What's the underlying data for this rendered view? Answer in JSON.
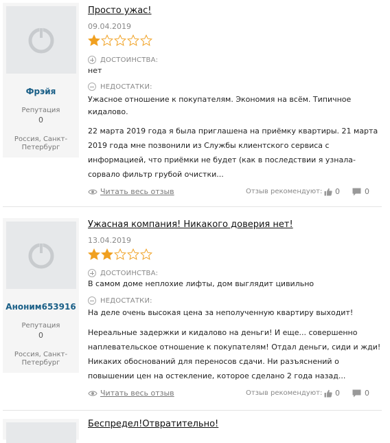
{
  "reviews": [
    {
      "user": {
        "name": "Фрэйя",
        "rep_label": "Репутация",
        "rep_value": "0",
        "location": "Россия, Санкт-Петербург"
      },
      "title": "Просто ужас!",
      "date": "09.04.2019",
      "rating": 1,
      "pros_label": "ДОСТОИНСТВА:",
      "pros": "нет",
      "cons_label": "НЕДОСТАТКИ:",
      "cons": "Ужасное отношение к покупателям. Экономия на всём. Типичное кидалово.",
      "body": "22 марта 2019 года я была приглашена на приёмку квартиры. 21 марта 2019 года мне позвонили из Службы клиентского сервиса с информацией, что приёмки не будет (как в последствии я узнала-сорвало фильтр грубой очистки...",
      "read_more": "Читать весь отзыв",
      "recommend_label": "Отзыв рекомендуют:",
      "likes": "0",
      "comments": "0"
    },
    {
      "user": {
        "name": "Аноним653916",
        "rep_label": "Репутация",
        "rep_value": "0",
        "location": "Россия, Санкт-Петербург"
      },
      "title": "Ужасная компания! Никакого доверия нет!",
      "date": "13.04.2019",
      "rating": 2,
      "pros_label": "ДОСТОИНСТВА:",
      "pros": "В самом доме неплохие лифты, дом выглядит цивильно",
      "cons_label": "НЕДОСТАТКИ:",
      "cons": "На деле очень высокая цена за неполученную квартиру выходит!",
      "body": "Нереальные задержки и кидалово на деньги! И еще... совершенно наплевательское отношение к покупателям! Отдал деньги, сиди и жди! Никаких обоснований для переносов сдачи. Ни разъяснений о повышении цен на остекление, которое сделано 2 года назад...",
      "read_more": "Читать весь отзыв",
      "recommend_label": "Отзыв рекомендуют:",
      "likes": "0",
      "comments": "0"
    },
    {
      "title": "Беспредел!Отвратительно!"
    }
  ],
  "colors": {
    "star_filled": "#f0a020",
    "star_empty_stroke": "#f0a020",
    "username": "#1a5f87",
    "avatar_bg": "#e6e8ea",
    "card_bg": "#f5f5f5"
  },
  "icons": {
    "avatar": "user-placeholder-icon",
    "read_more": "eye-icon",
    "likes": "thumbs-up-icon",
    "comments": "comment-icon",
    "pros": "plus-circle-icon",
    "cons": "minus-circle-icon",
    "star": "star-icon"
  }
}
